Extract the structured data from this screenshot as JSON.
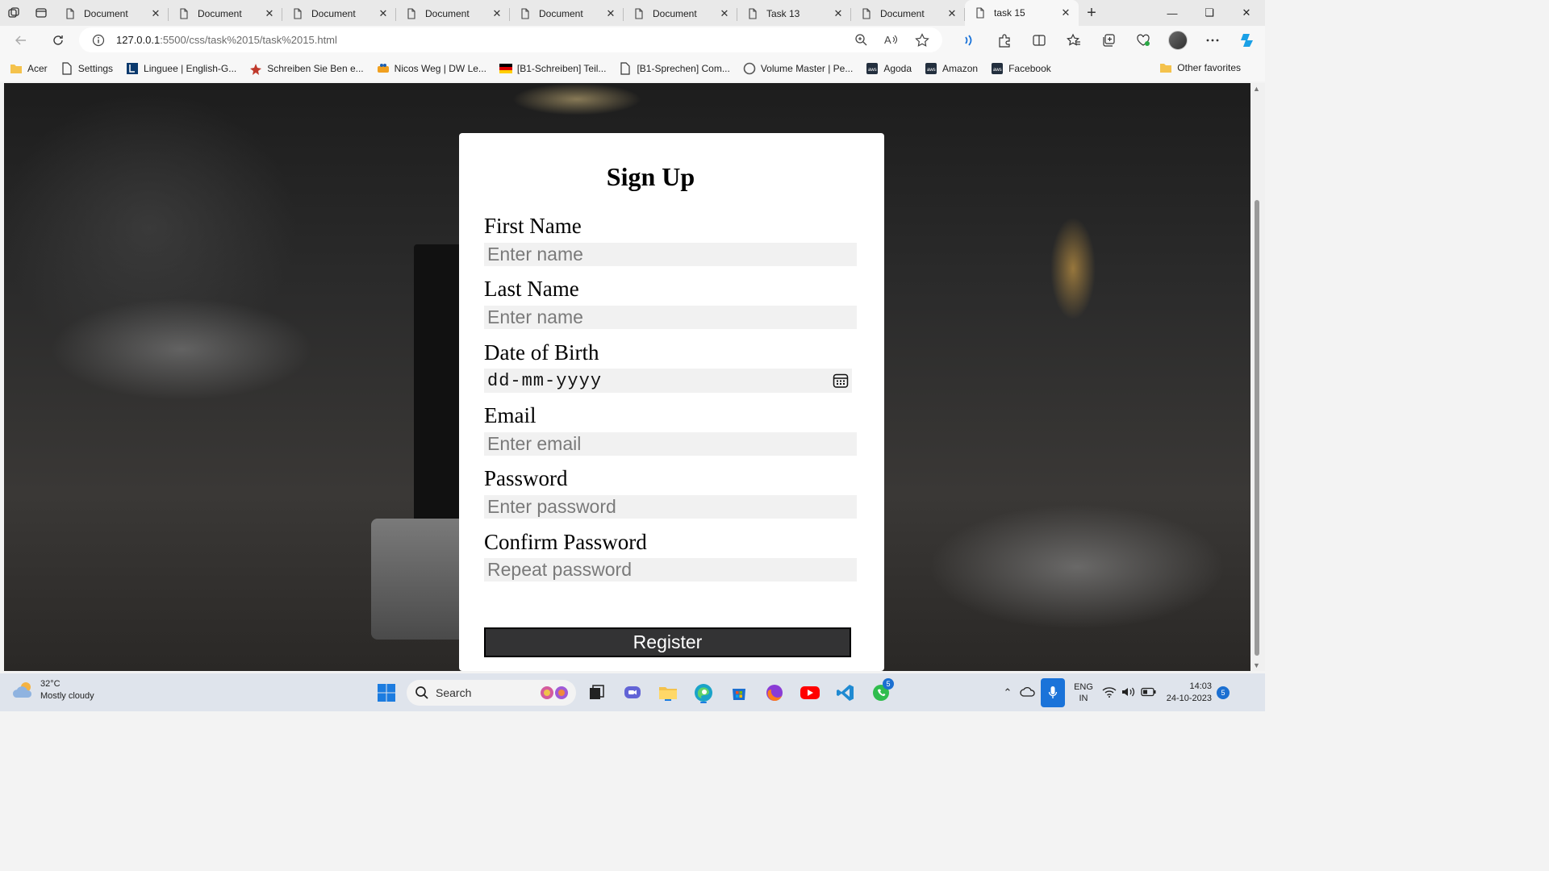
{
  "browser": {
    "tabs": [
      {
        "title": "Document",
        "active": false
      },
      {
        "title": "Document",
        "active": false
      },
      {
        "title": "Document",
        "active": false
      },
      {
        "title": "Document",
        "active": false
      },
      {
        "title": "Document",
        "active": false
      },
      {
        "title": "Document",
        "active": false
      },
      {
        "title": "Task 13",
        "active": false
      },
      {
        "title": "Document",
        "active": false
      },
      {
        "title": "task 15",
        "active": true
      }
    ],
    "url_host": "127.0.0.1",
    "url_path": ":5500/css/task%2015/task%2015.html",
    "bookmarks": [
      "Acer",
      "Settings",
      "Linguee | English-G...",
      "Schreiben Sie Ben e...",
      "Nicos Weg | DW Le...",
      "[B1-Schreiben] Teil...",
      "[B1-Sprechen] Com...",
      "Volume Master | Pe...",
      "Agoda",
      "Amazon",
      "Facebook"
    ],
    "other_favorites": "Other favorites"
  },
  "form": {
    "title": "Sign Up",
    "first_name_label": "First Name",
    "first_name_placeholder": "Enter name",
    "last_name_label": "Last Name",
    "last_name_placeholder": "Enter name",
    "dob_label": "Date of Birth",
    "dob_placeholder": "dd-mm-yyyy",
    "email_label": "Email",
    "email_placeholder": "Enter email",
    "password_label": "Password",
    "password_placeholder": "Enter password",
    "confirm_label": "Confirm Password",
    "confirm_placeholder": "Repeat password",
    "register_label": "Register"
  },
  "taskbar": {
    "temperature": "32°C",
    "weather": "Mostly cloudy",
    "search_label": "Search",
    "whatsapp_badge": "5",
    "lang_top": "ENG",
    "lang_bottom": "IN",
    "time": "14:03",
    "date": "24-10-2023",
    "notifications": "5"
  },
  "colors": {
    "register_button": "#333334",
    "input_background": "#f1f1f1",
    "taskbar": "#dfe4ec"
  }
}
